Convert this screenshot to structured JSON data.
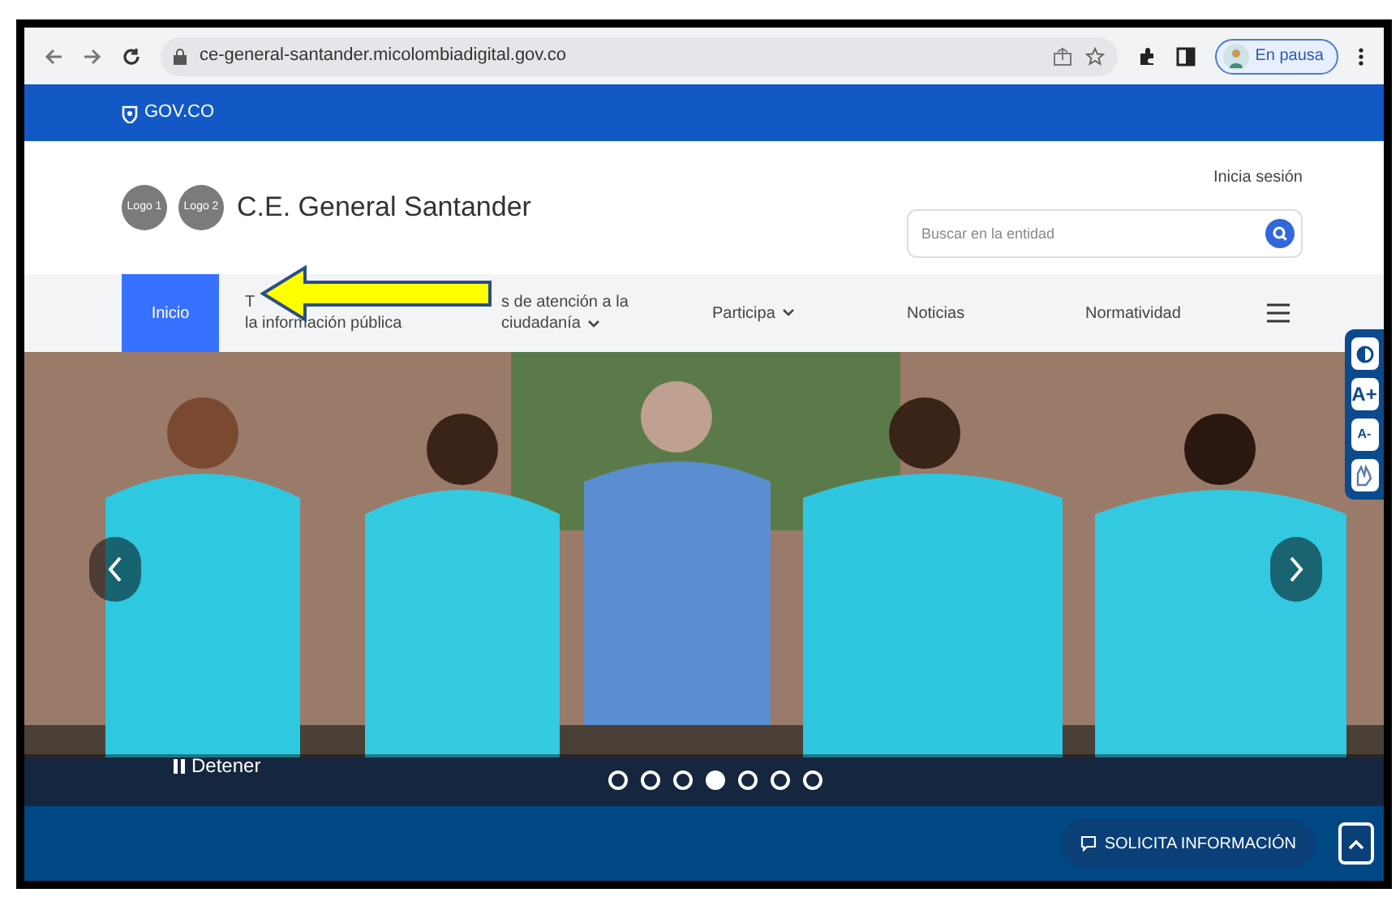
{
  "browser": {
    "url": "ce-general-santander.micolombiadigital.gov.co",
    "profile": "En pausa"
  },
  "gov_bar": {
    "label": "GOV.CO"
  },
  "header": {
    "logos": [
      "Logo 1",
      "Logo 2"
    ],
    "title": "C.E. General Santander",
    "login": "Inicia sesión",
    "search": {
      "placeholder": "Buscar en la entidad"
    }
  },
  "nav": [
    {
      "lines": [
        "Inicio"
      ],
      "selected": true,
      "dropdown": false
    },
    {
      "lines": [
        "T",
        "la información pública"
      ],
      "selected": false,
      "dropdown": false
    },
    {
      "lines": [
        "s de atención a la",
        "ciudadanía"
      ],
      "selected": false,
      "dropdown": true
    },
    {
      "lines": [
        "Participa"
      ],
      "selected": false,
      "dropdown": true
    },
    {
      "lines": [
        "Noticias"
      ],
      "selected": false,
      "dropdown": false
    },
    {
      "lines": [
        "Normatividad"
      ],
      "selected": false,
      "dropdown": false
    }
  ],
  "carousel": {
    "kind": "picture",
    "pause_label": "Detener",
    "dots": [
      {
        "selected": false
      },
      {
        "selected": false
      },
      {
        "selected": false
      },
      {
        "selected": true
      },
      {
        "selected": false
      },
      {
        "selected": false
      },
      {
        "selected": false
      }
    ]
  },
  "accessibility": [
    {
      "kind": "contrast"
    },
    {
      "kind": "text",
      "label": "A+"
    },
    {
      "kind": "text",
      "label": "A-"
    },
    {
      "kind": "sign"
    }
  ],
  "footer": {
    "button": "SOLICITA INFORMACIÓN"
  }
}
